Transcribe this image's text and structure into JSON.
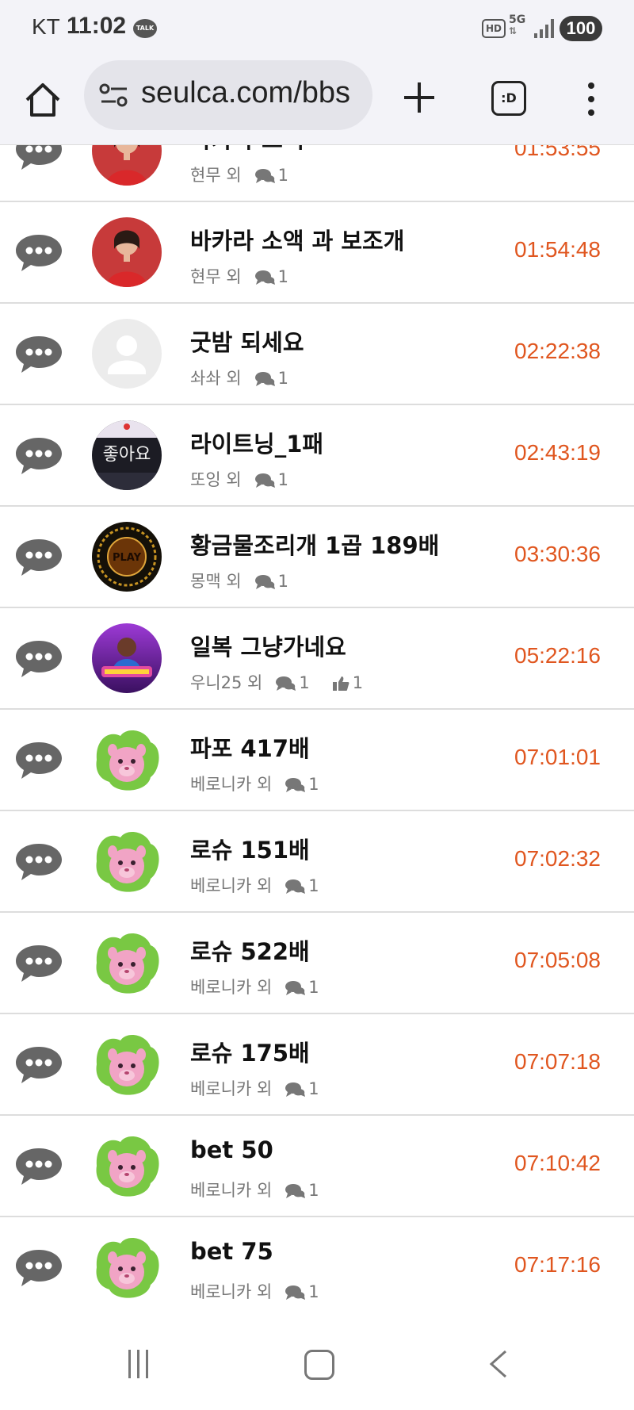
{
  "status_bar": {
    "carrier": "KT",
    "time": "11:02",
    "talk_badge": "TALK",
    "hd": "HD",
    "network": "5G",
    "battery": "100"
  },
  "browser": {
    "url": "seulca.com/bbs",
    "tabs_label": ":D"
  },
  "rows": [
    {
      "title": "바카라 소액",
      "author": "현무 외",
      "comments": "1",
      "time": "01:53:55",
      "avatar": "woman-red"
    },
    {
      "title": "바카라 소액 과 보조개",
      "author": "현무 외",
      "comments": "1",
      "time": "01:54:48",
      "avatar": "woman-red"
    },
    {
      "title": "굿밤 되세요",
      "author": "솨솨 외",
      "comments": "1",
      "time": "02:22:38",
      "avatar": "default"
    },
    {
      "title": "라이트닝_1패",
      "author": "또잉 외",
      "comments": "1",
      "time": "02:43:19",
      "avatar": "sign"
    },
    {
      "title": "황금물조리개 1곱 189배",
      "author": "몽맥 외",
      "comments": "1",
      "time": "03:30:36",
      "avatar": "play"
    },
    {
      "title": "일복 그냥가네요",
      "author": "우니25 외",
      "comments": "1",
      "likes": "1",
      "time": "05:22:16",
      "avatar": "game"
    },
    {
      "title": "파포 417배",
      "author": "베로니카 외",
      "comments": "1",
      "time": "07:01:01",
      "avatar": "pink"
    },
    {
      "title": "로슈 151배",
      "author": "베로니카 외",
      "comments": "1",
      "time": "07:02:32",
      "avatar": "pink"
    },
    {
      "title": "로슈 522배",
      "author": "베로니카 외",
      "comments": "1",
      "time": "07:05:08",
      "avatar": "pink"
    },
    {
      "title": "로슈 175배",
      "author": "베로니카 외",
      "comments": "1",
      "time": "07:07:18",
      "avatar": "pink"
    },
    {
      "title": "bet 50",
      "author": "베로니카 외",
      "comments": "1",
      "time": "07:10:42",
      "avatar": "pink"
    },
    {
      "title": "bet 75",
      "author": "베로니카 외",
      "comments": "1",
      "time": "07:17:16",
      "avatar": "pink"
    }
  ],
  "sign_text": "좋아요",
  "play_text": "PLAY",
  "colors": {
    "time": "#e0561f",
    "bubble": "#666666",
    "meta": "#777777"
  }
}
